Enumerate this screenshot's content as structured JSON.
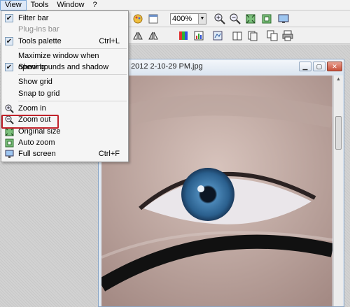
{
  "menubar": {
    "items": [
      {
        "label": "View",
        "active": true
      },
      {
        "label": "Tools"
      },
      {
        "label": "Window"
      },
      {
        "label": "?"
      }
    ]
  },
  "toolbar": {
    "zoom_value": "400%"
  },
  "image_window": {
    "title": "2012 2-10-29 PM.jpg"
  },
  "view_menu": {
    "items": [
      {
        "label": "Filter bar",
        "checked": true
      },
      {
        "label": "Plug-ins bar",
        "disabled": true
      },
      {
        "label": "Tools palette",
        "checked": true,
        "shortcut": "Ctrl+L"
      },
      {
        "label": "Maximize window when opening"
      },
      {
        "label": "Show bounds and shadow",
        "checked": true
      },
      {
        "label": "Show grid"
      },
      {
        "label": "Snap to grid"
      },
      {
        "label": "Zoom in",
        "icon": "zoom-in-icon",
        "highlighted": true
      },
      {
        "label": "Zoom out",
        "icon": "zoom-out-icon"
      },
      {
        "label": "Original size",
        "icon": "original-size-icon"
      },
      {
        "label": "Auto zoom",
        "icon": "auto-zoom-icon"
      },
      {
        "label": "Full screen",
        "icon": "full-screen-icon",
        "shortcut": "Ctrl+F"
      }
    ]
  },
  "colors": {
    "highlight_border": "#c0222a",
    "menu_active_bg": "#dde8f7"
  }
}
